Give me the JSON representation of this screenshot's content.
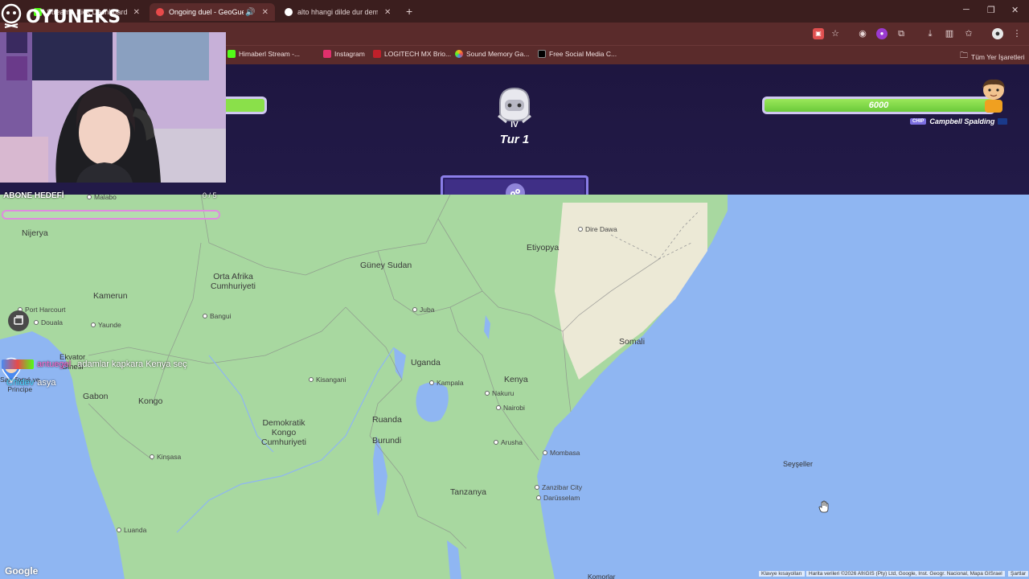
{
  "browser": {
    "tabs": [
      {
        "title": "Stream - Kick Dashboard",
        "active": false,
        "favicon_color": "#53fc18"
      },
      {
        "title": "Ongoing duel - GeoGuessr",
        "active": true,
        "favicon_color": "#e84a4a"
      },
      {
        "title": "alto hhangi dilde dur demek - G",
        "active": false,
        "favicon_color": "#4a8af0"
      }
    ],
    "new_tab": "+",
    "window_controls": {
      "minimize": "─",
      "maximize": "❐",
      "close": "✕"
    },
    "bookmarks": [
      {
        "label": "Himaberl Stream -...",
        "color": "#53fc18"
      },
      {
        "label": "Instagram",
        "color": "#e1306c"
      },
      {
        "label": "LOGITECH MX Brio...",
        "color": "#c0202a"
      },
      {
        "label": "Sound Memory Ga...",
        "color": "#ffb020"
      },
      {
        "label": "Free Social Media C...",
        "color": "#000000"
      }
    ],
    "all_bookmarks": "Tüm Yer İşaretleri"
  },
  "game": {
    "round_label": "Tur 1",
    "round_numeral": "IV",
    "opponent_health": "6000",
    "opponent_tag": "CHIP",
    "opponent_name": "Campbell Spalding"
  },
  "map": {
    "countries": [
      {
        "name": "Nijerya"
      },
      {
        "name": "Kamerun"
      },
      {
        "name": "Orta Afrika\nCumhuriyeti"
      },
      {
        "name": "Güney Sudan"
      },
      {
        "name": "Etiyopya"
      },
      {
        "name": "Somali"
      },
      {
        "name": "Uganda"
      },
      {
        "name": "Kenya"
      },
      {
        "name": "Gabon"
      },
      {
        "name": "Kongo"
      },
      {
        "name": "Demokratik\nKongo\nCumhuriyeti"
      },
      {
        "name": "Ruanda"
      },
      {
        "name": "Burundi"
      },
      {
        "name": "Tanzanya"
      },
      {
        "name": "Seyşeller"
      },
      {
        "name": "Ekvator\nGinesi"
      },
      {
        "name": "Sao Tomé ve\nPrincipe"
      }
    ],
    "cities": [
      {
        "name": "Port Harcourt"
      },
      {
        "name": "Douala"
      },
      {
        "name": "Yaunde"
      },
      {
        "name": "Bangui"
      },
      {
        "name": "Juba"
      },
      {
        "name": "Dire Dawa"
      },
      {
        "name": "Kampala"
      },
      {
        "name": "Nakuru"
      },
      {
        "name": "Nairobi"
      },
      {
        "name": "Kisangani"
      },
      {
        "name": "Arusha"
      },
      {
        "name": "Mombasa"
      },
      {
        "name": "Zanzibar City"
      },
      {
        "name": "Darüsselam"
      },
      {
        "name": "Kinşasa"
      },
      {
        "name": "Luanda"
      },
      {
        "name": "Malabo"
      },
      {
        "name": "Komorlar"
      }
    ],
    "google": "Google",
    "attribution": {
      "shortcuts": "Klavye kısayolları",
      "data": "Harita verileri ©2026 AfriGIS (Pty) Ltd, Google, Inst. Geogr. Nacional, Mapa GISrael",
      "terms": "Şartlar"
    }
  },
  "overlay": {
    "brand": "OYUNEKS",
    "sub_goal_label": "ABONE HEDEFİ",
    "sub_goal_count": "0 / 5",
    "chat": [
      {
        "user": "antuegel",
        "text": "adamlar kapkara Kenya seç"
      },
      {
        "user": "Chidev",
        "text": "asya"
      }
    ]
  }
}
